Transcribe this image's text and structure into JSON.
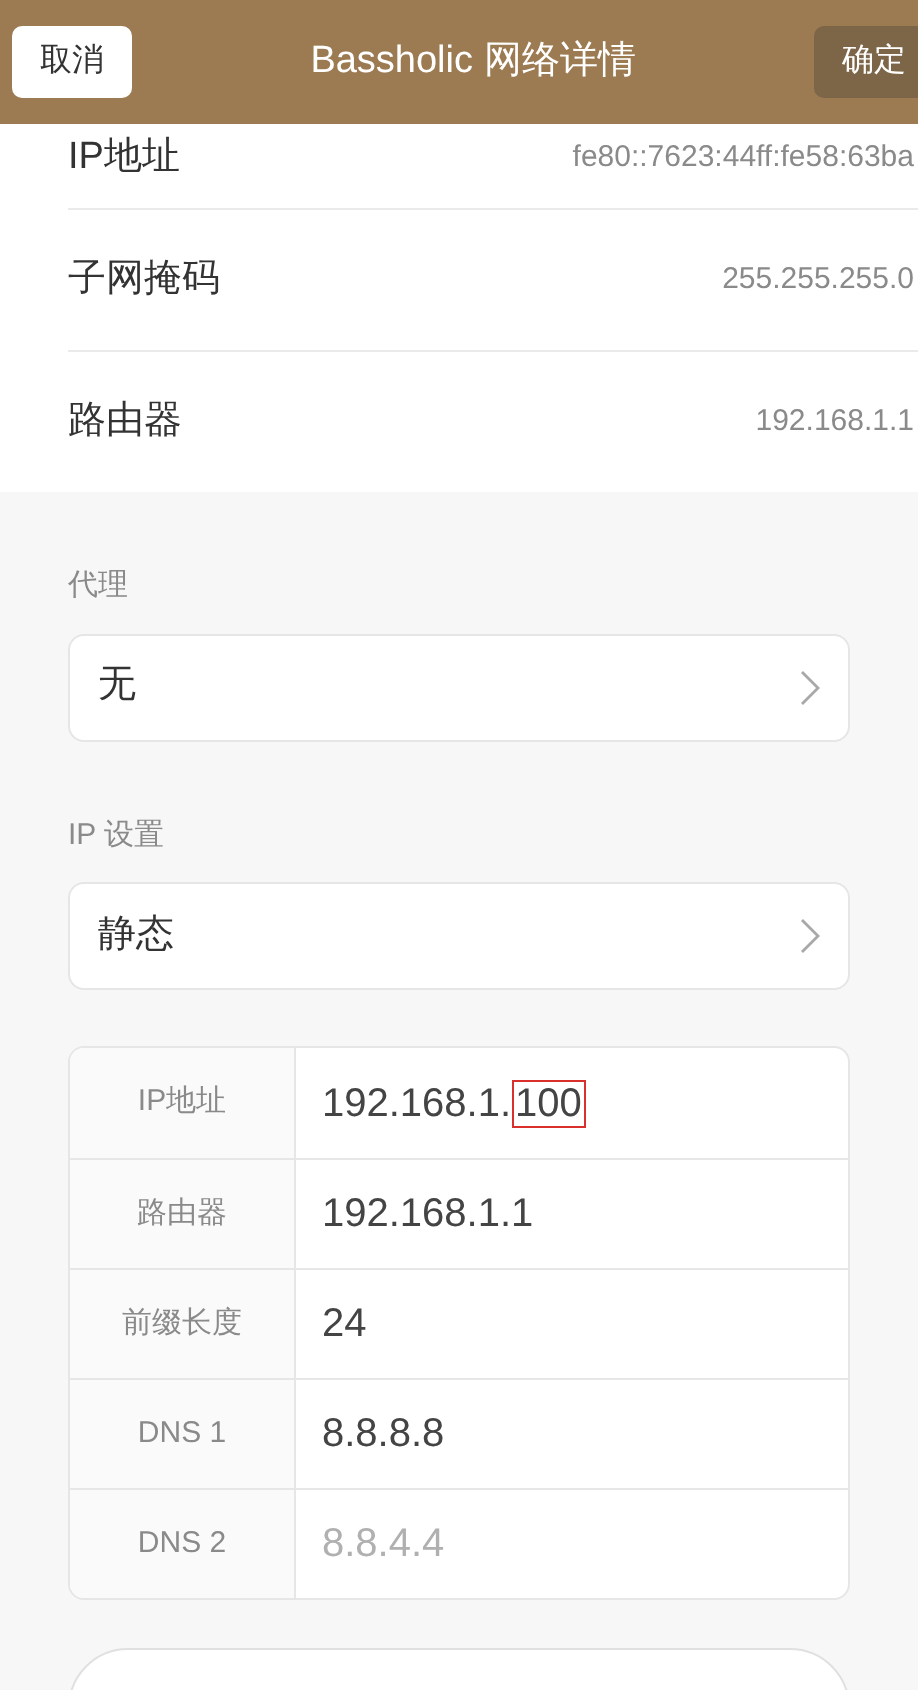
{
  "header": {
    "cancel": "取消",
    "title": "Bassholic 网络详情",
    "confirm": "确定"
  },
  "info_rows": [
    {
      "label": "IP地址",
      "value": "fe80::7623:44ff:fe58:63ba"
    },
    {
      "label": "子网掩码",
      "value": "255.255.255.0"
    },
    {
      "label": "路由器",
      "value": "192.168.1.1"
    }
  ],
  "proxy": {
    "heading": "代理",
    "value": "无"
  },
  "ip_settings": {
    "heading": "IP 设置",
    "value": "静态"
  },
  "static_fields": [
    {
      "label": "IP地址",
      "value": "192.168.1.",
      "highlight": "100",
      "kind": "value"
    },
    {
      "label": "路由器",
      "value": "192.168.1.1",
      "kind": "value"
    },
    {
      "label": "前缀长度",
      "value": "24",
      "kind": "value"
    },
    {
      "label": "DNS 1",
      "value": "8.8.8.8",
      "kind": "value"
    },
    {
      "label": "DNS 2",
      "placeholder": "8.8.4.4",
      "kind": "placeholder"
    }
  ]
}
